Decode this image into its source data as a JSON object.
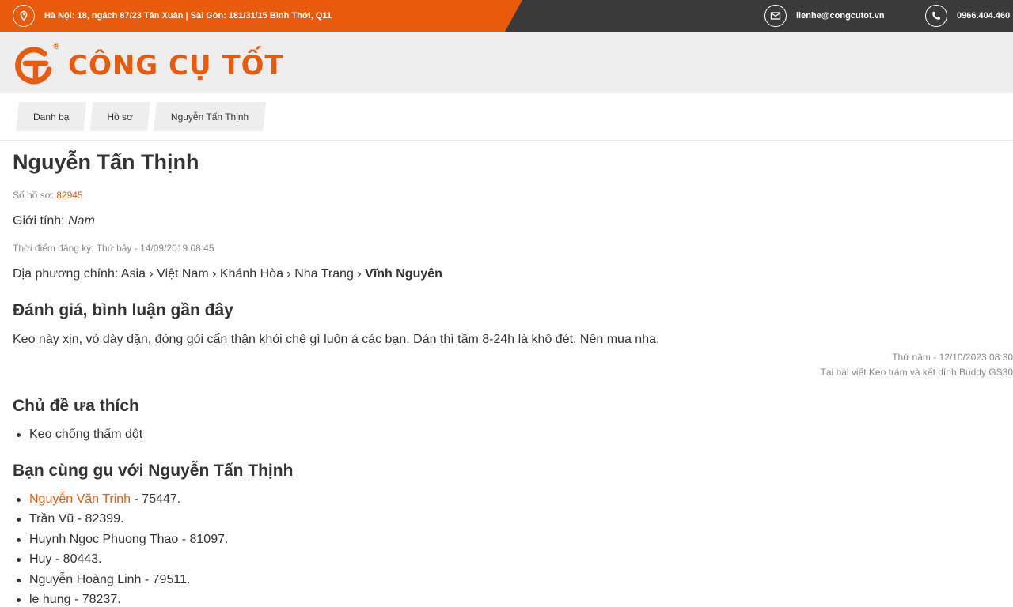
{
  "topbar": {
    "address": "Hà Nội: 18, ngách 87/23 Tân Xuân | Sài Gòn: 181/31/15 Bình Thới, Q11",
    "email": "lienhe@congcutot.vn",
    "phone": "0966.404.460",
    "icons": [
      "location-icon",
      "mail-icon",
      "phone-icon"
    ]
  },
  "logo": {
    "text": "CÔNG CỤ TỐT",
    "registered": "®"
  },
  "breadcrumb": [
    "Danh bạ",
    "Hồ sơ",
    "Nguyễn Tấn Thịnh"
  ],
  "profile": {
    "name": "Nguyễn Tấn Thịnh",
    "id_label": "Số hồ sơ:",
    "id": "82945",
    "gender_label": "Giới tính:",
    "gender": "Nam",
    "registered": "Thời điểm đăng ký: Thứ bảy - 14/09/2019 08:45",
    "location_label": "Địa phương chính:",
    "location_path": "Asia › Việt Nam › Khánh Hòa › Nha Trang ›",
    "location_final": "Vĩnh Nguyên"
  },
  "reviews": {
    "heading": "Đánh giá, bình luận gần đây",
    "items": [
      {
        "text": "Keo này xịn, vỏ dày dặn, đóng gói cẩn thận khỏi chê gì luôn á các bạn. Dán thì tầm 8-24h là khô đét. Nên mua nha.",
        "date": "Thứ năm - 12/10/2023 08:30",
        "source": "Tại bài viết Keo trám và kết dính Buddy GS30"
      }
    ]
  },
  "topics": {
    "heading": "Chủ đề ưa thích",
    "items": [
      "Keo chống thấm dột"
    ]
  },
  "similar": {
    "heading": "Bạn cùng gu với Nguyễn Tấn Thịnh",
    "items": [
      {
        "name": "Nguyễn Văn Trinh",
        "suffix": " - 75447."
      },
      {
        "name": "Trần Vũ",
        "suffix": " - 82399."
      },
      {
        "name": "Huynh Ngoc Phuong Thao",
        "suffix": " - 81097."
      },
      {
        "name": "Huy",
        "suffix": " - 80443."
      },
      {
        "name": "Nguyễn Hoàng Linh",
        "suffix": " - 79511."
      },
      {
        "name": "le hung",
        "suffix": " - 78237."
      }
    ]
  },
  "colors": {
    "accent": "#e95b0b",
    "dark": "#3a3a3a",
    "header_bg": "#eeeeee"
  }
}
